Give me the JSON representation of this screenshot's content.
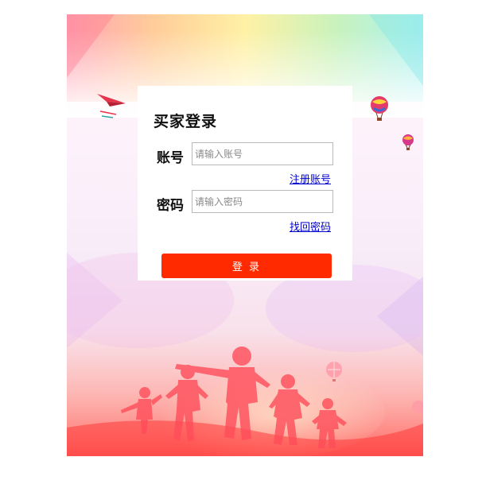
{
  "login": {
    "title": "买家登录",
    "account_label": "账号",
    "account_placeholder": "请输入账号",
    "account_value": "",
    "register_link": "注册账号",
    "password_label": "密码",
    "password_placeholder": "请输入密码",
    "password_value": "",
    "recover_link": "找回密码",
    "submit_label": "登 录"
  },
  "colors": {
    "button": "#ff2a00",
    "link": "#0000cc",
    "card": "#ffffff"
  },
  "background": {
    "decorations": [
      "paper-plane-icon",
      "hot-air-balloon-icon",
      "running-children-silhouette"
    ]
  }
}
